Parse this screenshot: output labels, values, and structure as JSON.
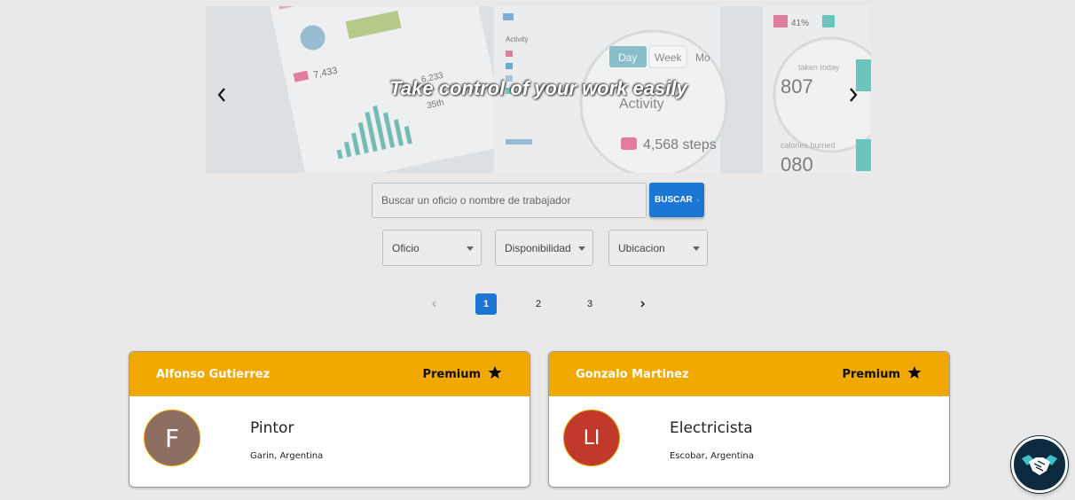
{
  "carousel": {
    "caption": "Take control of your work easily",
    "bg_labels": {
      "activity": "Activity",
      "steps": "4,568 steps",
      "day": "Day",
      "week": "Week",
      "mo": "Mo",
      "big_number": "807",
      "big_number2": "080",
      "small1": "41%",
      "small2": "7,433",
      "small3": "6,233",
      "small4": "35th",
      "taken_today": "taken today",
      "burned": "calories burned"
    }
  },
  "search": {
    "placeholder": "Buscar un oficio o nombre de trabajador",
    "button_label": "BUSCAR"
  },
  "filters": [
    {
      "label": "Oficio"
    },
    {
      "label": "Disponibilidad"
    },
    {
      "label": "Ubicacion"
    }
  ],
  "pagination": {
    "pages": [
      "1",
      "2",
      "3"
    ],
    "current": "1"
  },
  "workers": [
    {
      "name": "Alfonso Gutierrez",
      "tier": "Premium",
      "initials": "F",
      "avatar_color": "#8d6e63",
      "trade": "Pintor",
      "location": "Garin, Argentina"
    },
    {
      "name": "Gonzalo Martinez",
      "tier": "Premium",
      "initials": "LI",
      "avatar_color": "#c0392b",
      "trade": "Electricista",
      "location": "Escobar, Argentina"
    }
  ],
  "colors": {
    "accent": "#1a76d2",
    "card_header": "#f1a800",
    "page_bg": "#e9e9e9"
  },
  "icons": {
    "prev": "chevron-left-icon",
    "next": "chevron-right-icon",
    "search": "search-icon",
    "star": "star-icon",
    "chat": "handshake-icon"
  }
}
